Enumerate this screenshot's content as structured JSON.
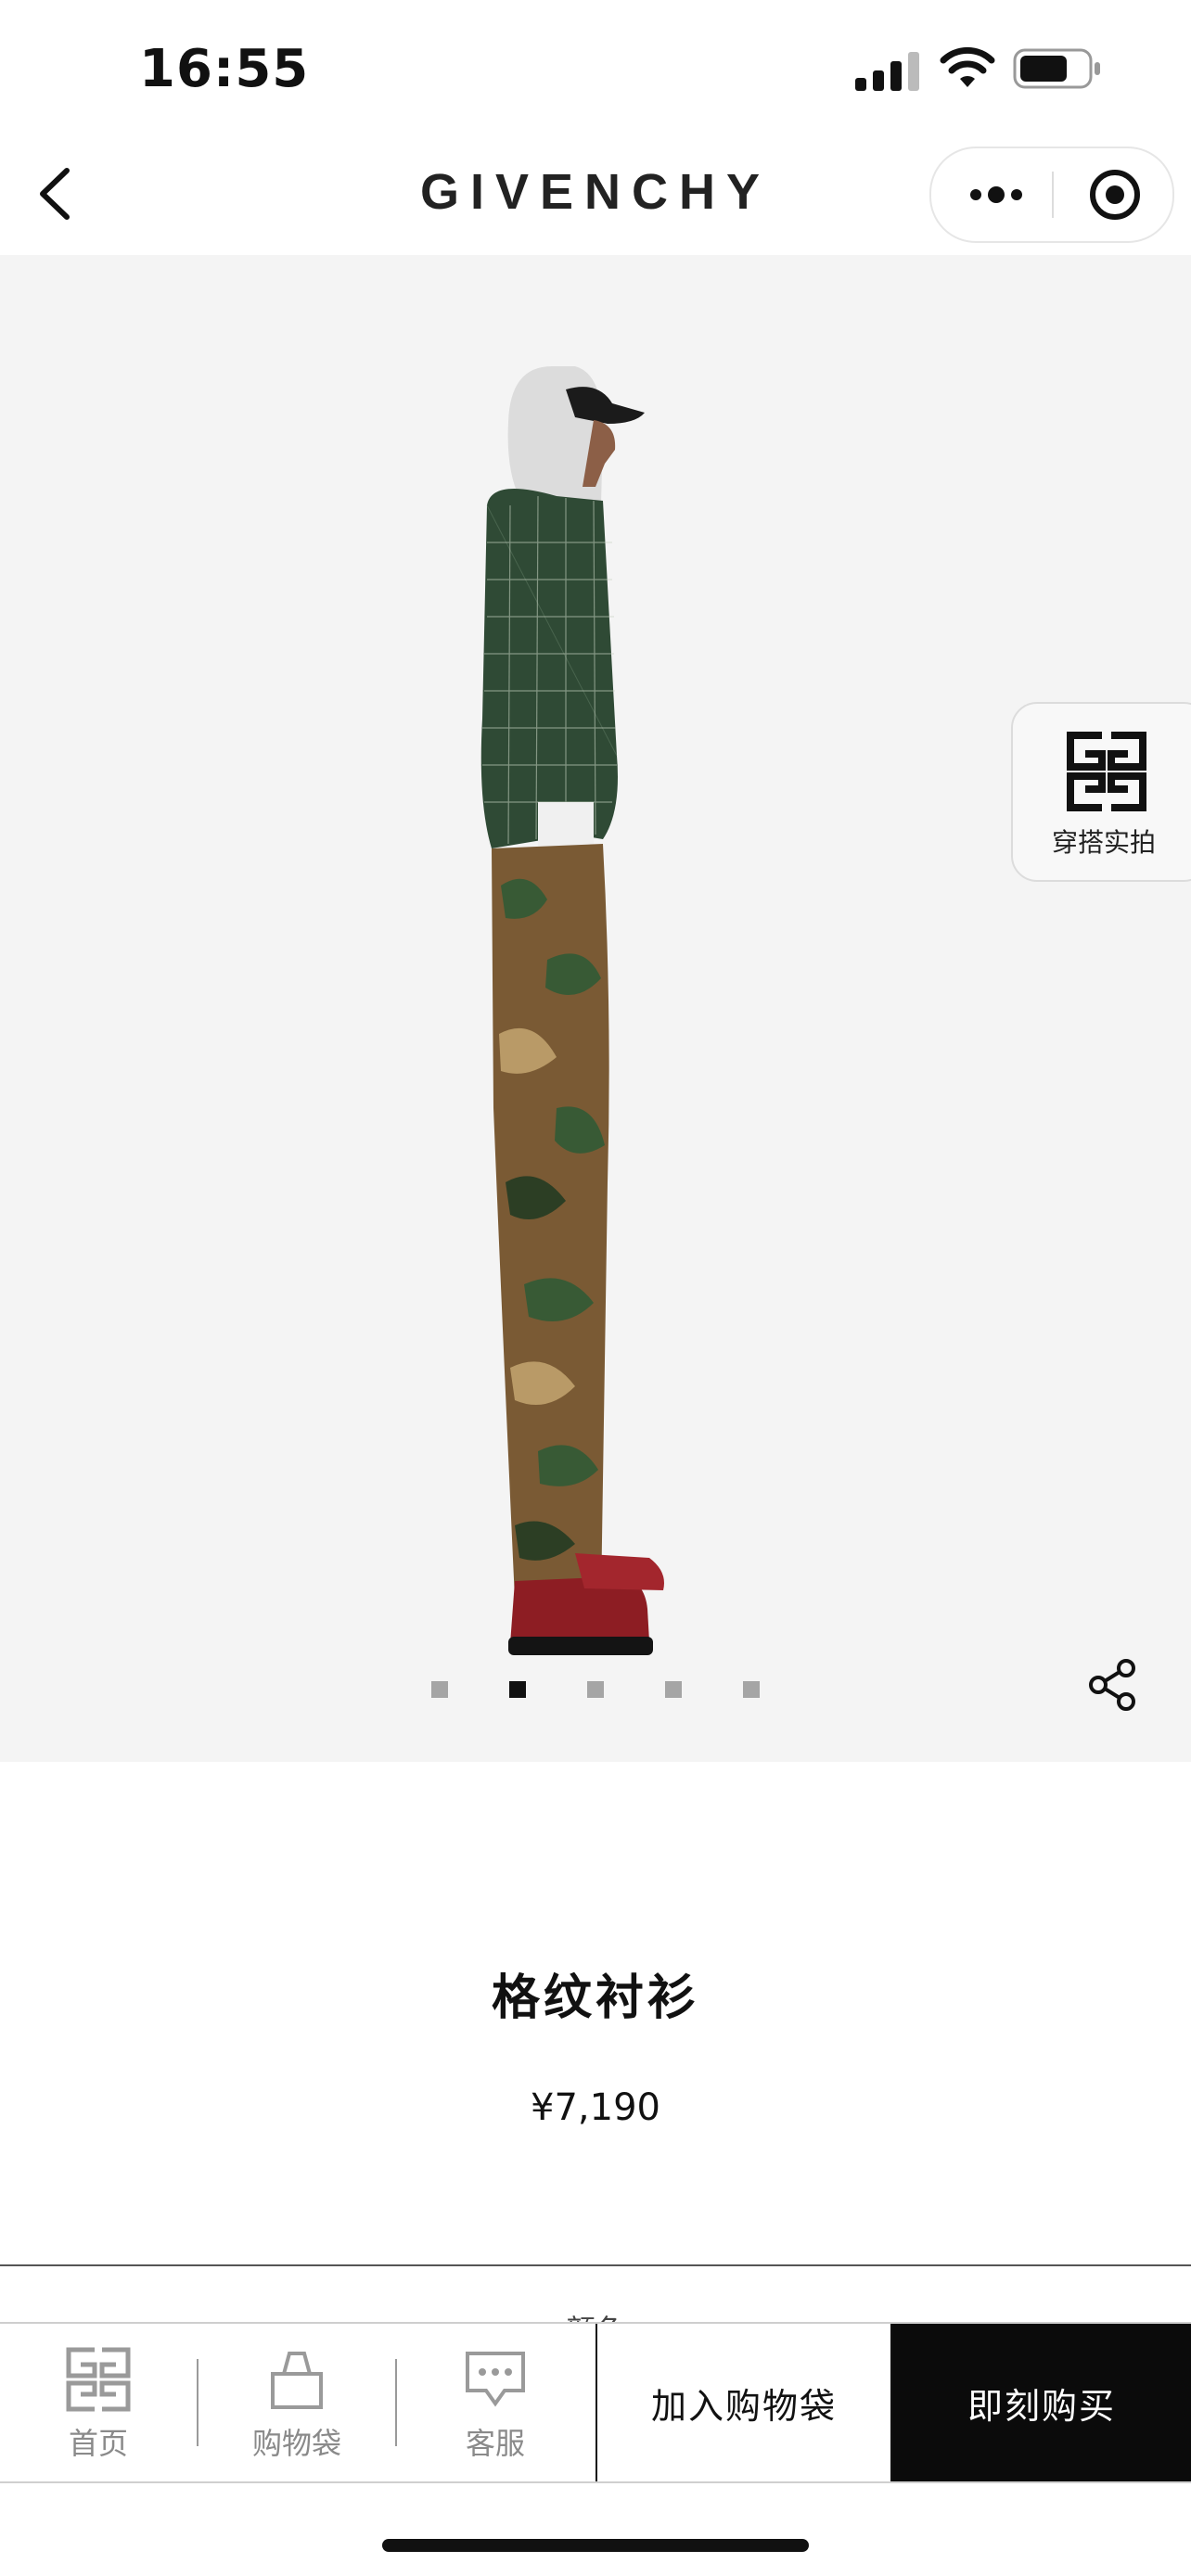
{
  "status_bar": {
    "time": "16:55"
  },
  "nav": {
    "brand": "GIVENCHY",
    "icons": {
      "back": "chevron-left-icon",
      "more": "more-dots-icon",
      "target": "target-icon"
    }
  },
  "gallery": {
    "image_count": 5,
    "active_index": 1,
    "lookbook_label": "穿搭实拍",
    "share_icon": "share-icon"
  },
  "product": {
    "name": "格纹衬衫",
    "price": "¥7,190",
    "color_label_peek": "颜色"
  },
  "bottom_bar": {
    "tabs": [
      {
        "label": "首页",
        "icon": "givenchy-logo-icon"
      },
      {
        "label": "购物袋",
        "icon": "shopping-bag-icon"
      },
      {
        "label": "客服",
        "icon": "chat-icon"
      }
    ],
    "add_to_bag": "加入购物袋",
    "buy_now": "即刻购买"
  },
  "colors": {
    "accent": "#0b0b0b",
    "hero_bg": "#f4f4f4",
    "tab_gray": "#8a8a8a"
  }
}
